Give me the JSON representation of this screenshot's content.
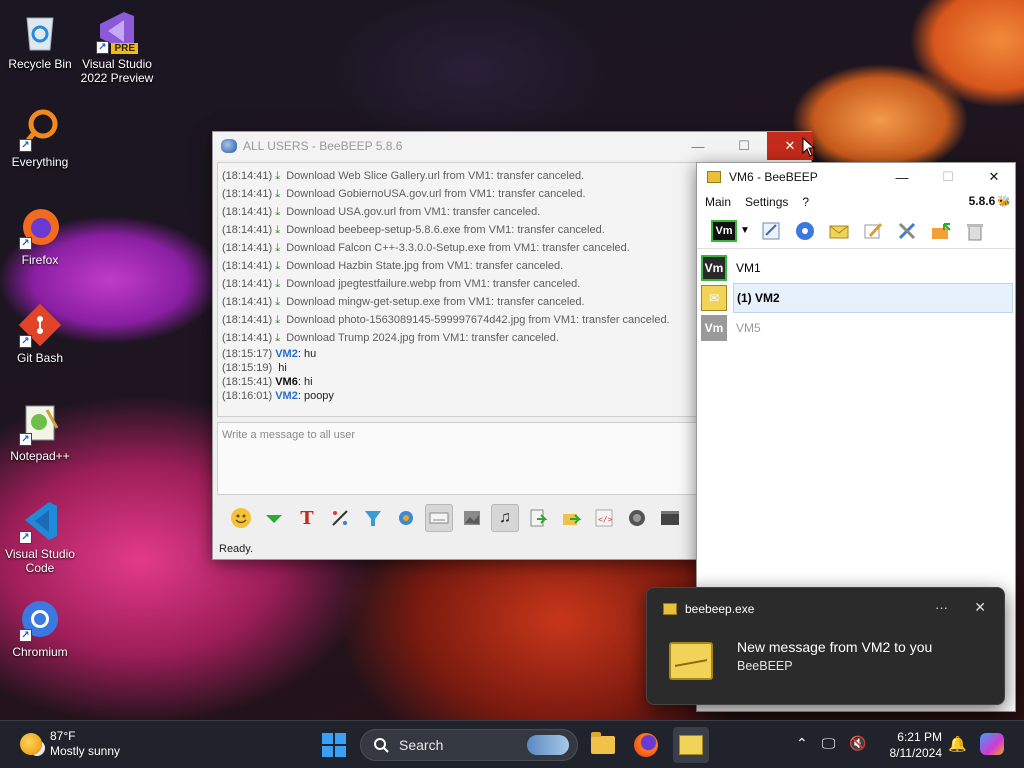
{
  "desktop": {
    "icons": [
      {
        "label": "Recycle Bin",
        "icon": "recycle-bin-icon"
      },
      {
        "label": "Visual Studio 2022 Preview",
        "icon": "visual-studio-preview-icon",
        "badge": "PRE"
      },
      {
        "label": "Everything",
        "icon": "everything-search-icon"
      },
      {
        "label": "Firefox",
        "icon": "firefox-icon"
      },
      {
        "label": "Git Bash",
        "icon": "git-bash-icon"
      },
      {
        "label": "Notepad++",
        "icon": "notepadpp-icon"
      },
      {
        "label": "Visual Studio Code",
        "icon": "vscode-icon"
      },
      {
        "label": "Chromium",
        "icon": "chromium-icon"
      }
    ]
  },
  "all_users_window": {
    "title": "ALL USERS - BeeBEEP 5.8.6",
    "messages": [
      {
        "time": "(18:14:41)",
        "text": "Download Web Slice Gallery.url from VM1: transfer canceled."
      },
      {
        "time": "(18:14:41)",
        "text": "Download GobiernoUSA.gov.url from VM1: transfer canceled."
      },
      {
        "time": "(18:14:41)",
        "text": "Download USA.gov.url from VM1: transfer canceled."
      },
      {
        "time": "(18:14:41)",
        "text": "Download beebeep-setup-5.8.6.exe from VM1: transfer canceled."
      },
      {
        "time": "(18:14:41)",
        "text": "Download Falcon C++-3.3.0.0-Setup.exe from VM1: transfer canceled."
      },
      {
        "time": "(18:14:41)",
        "text": "Download Hazbin State.jpg from VM1: transfer canceled."
      },
      {
        "time": "(18:14:41)",
        "text": "Download jpegtestfailure.webp from VM1: transfer canceled."
      },
      {
        "time": "(18:14:41)",
        "text": "Download mingw-get-setup.exe from VM1: transfer canceled."
      },
      {
        "time": "(18:14:41)",
        "text": "Download photo-1563089145-599997674d42.jpg from VM1: transfer canceled."
      },
      {
        "time": "(18:14:41)",
        "text": "Download Trump 2024.jpg from VM1: transfer canceled."
      }
    ],
    "chat": [
      {
        "time": "(18:15:17)",
        "sender": "VM2",
        "text": ": hu",
        "color": "blue"
      },
      {
        "time": "(18:15:19)",
        "sender": "",
        "text": "hi",
        "color": "none"
      },
      {
        "time": "(18:15:41)",
        "sender": "VM6",
        "text": ": hi",
        "color": "black"
      },
      {
        "time": "(18:16:01)",
        "sender": "VM2",
        "text": ": poopy",
        "color": "blue"
      }
    ],
    "input_placeholder": "Write a message to all user",
    "status": "Ready.",
    "toolbar_icons": [
      "emoji-icon",
      "expand-down-icon",
      "font-icon",
      "color-picker-icon",
      "filter-icon",
      "settings-gear-icon",
      "keyboard-icon",
      "image-icon",
      "music-icon",
      "send-file-icon",
      "send-folder-icon",
      "html-code-icon",
      "record-icon",
      "terminal-icon"
    ]
  },
  "vm6_window": {
    "title": "VM6 - BeeBEEP",
    "menu": [
      "Main",
      "Settings",
      "?"
    ],
    "version": "5.8.6",
    "toolbar_badge": "Vm",
    "users": [
      {
        "avatar": "Vm",
        "name": "VM1",
        "state": "online"
      },
      {
        "avatar": "",
        "name": "(1) VM2",
        "state": "new-message"
      },
      {
        "avatar": "Vm",
        "name": "VM5",
        "state": "offline"
      }
    ]
  },
  "toast": {
    "app": "beebeep.exe",
    "more": "···",
    "message": "New message from VM2 to you",
    "source": "BeeBEEP"
  },
  "taskbar": {
    "temperature": "87°F",
    "weather": "Mostly sunny",
    "search": "Search",
    "time": "6:21 PM",
    "date": "8/11/2024"
  },
  "colors": {
    "accent_blue": "#2a6fd0",
    "close_red": "#c42b1c",
    "online_green": "#35b83a"
  }
}
